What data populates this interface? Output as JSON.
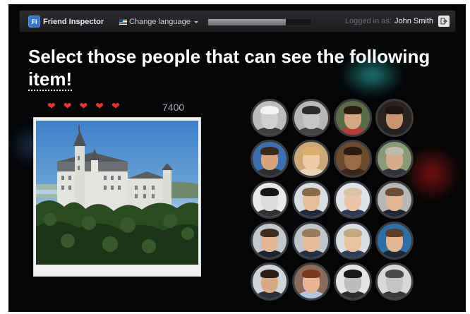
{
  "navbar": {
    "brand": "Friend Inspector",
    "brand_logo": "FI",
    "language_label": "Change language",
    "progress_fraction": 0.75,
    "login_label": "Logged in as:",
    "user_name": "John Smith",
    "logout_icon": "logout-icon"
  },
  "heading": {
    "line": "Select those people that can see the following",
    "item_word": "item!"
  },
  "lives": {
    "count": 5,
    "icon": "heart-icon",
    "color": "#e8342c"
  },
  "score": "7400",
  "item": {
    "kind": "photo",
    "subject": "castle"
  },
  "faces": [
    {
      "bg": "#bdbdbd",
      "skin": "#cfcfcf",
      "hair": "#f2f2f2",
      "shirt": "#3d3d3d"
    },
    {
      "bg": "#b7b7b7",
      "skin": "#c7c7c7",
      "hair": "#2b2b2b",
      "shirt": "#444444"
    },
    {
      "bg": "#5a6b48",
      "skin": "#d6a785",
      "hair": "#2a1a10",
      "shirt": "#b73b3b"
    },
    {
      "bg": "#2b2320",
      "skin": "#c99474",
      "hair": "#1b1410",
      "shirt": "#222222"
    },
    {
      "bg": "#3a6fb0",
      "skin": "#d7a37c",
      "hair": "#3b2a1c",
      "shirt": "#2f2f2f"
    },
    {
      "bg": "#caa878",
      "skin": "#f0c9a6",
      "hair": "#d9b070",
      "shirt": "#e8d2b8"
    },
    {
      "bg": "#6b4a2d",
      "skin": "#9a6b44",
      "hair": "#2a1a10",
      "shirt": "#3b2718"
    },
    {
      "bg": "#8a9a78",
      "skin": "#d5ab8b",
      "hair": "#c0b9ae",
      "shirt": "#2e3440"
    },
    {
      "bg": "#e9e9e9",
      "skin": "#dcdcdc",
      "hair": "#151515",
      "shirt": "#333333"
    },
    {
      "bg": "#d7dde3",
      "skin": "#e7bc9c",
      "hair": "#8a6a4a",
      "shirt": "#1f2a3a"
    },
    {
      "bg": "#dfe3e7",
      "skin": "#ebc4a8",
      "hair": "#d9c3a6",
      "shirt": "#2b3a57"
    },
    {
      "bg": "#b7b7b7",
      "skin": "#e0b596",
      "hair": "#6b4d35",
      "shirt": "#202632"
    },
    {
      "bg": "#c2c7cc",
      "skin": "#e2b697",
      "hair": "#3f2d1f",
      "shirt": "#1b2230"
    },
    {
      "bg": "#bfc5cb",
      "skin": "#e6bb9b",
      "hair": "#9a7b59",
      "shirt": "#243042"
    },
    {
      "bg": "#d8dde2",
      "skin": "#e9c2a2",
      "hair": "#c3a980",
      "shirt": "#2f3d58"
    },
    {
      "bg": "#2f6fa5",
      "skin": "#e2b592",
      "hair": "#5a3f2a",
      "shirt": "#1c2736"
    },
    {
      "bg": "#cfd4da",
      "skin": "#d9a984",
      "hair": "#2a1e15",
      "shirt": "#2a2f38"
    },
    {
      "bg": "#8a6a5a",
      "skin": "#e8b696",
      "hair": "#7a3a22",
      "shirt": "#b7c6e0"
    },
    {
      "bg": "#e4e4e4",
      "skin": "#bdbdbd",
      "hair": "#1a1a1a",
      "shirt": "#2d2d2d"
    },
    {
      "bg": "#d8d8d8",
      "skin": "#c4c4c4",
      "hair": "#4a4a4a",
      "shirt": "#3a3a3a"
    }
  ]
}
